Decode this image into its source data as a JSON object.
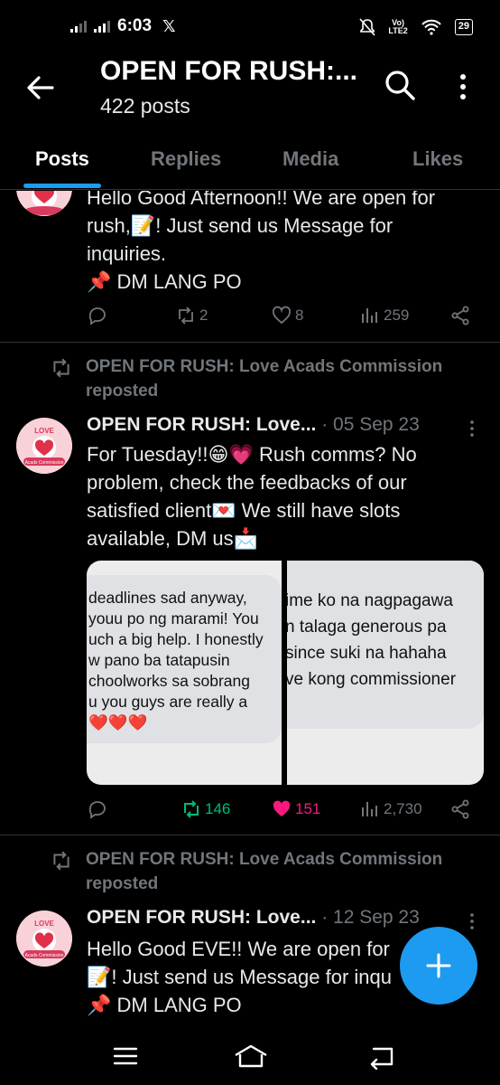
{
  "status_bar": {
    "time": "6:03",
    "x_glyph": "𝕏",
    "lte_label": "LTE2",
    "battery": "29"
  },
  "header": {
    "title": "OPEN FOR RUSH:...",
    "subtitle": "422 posts"
  },
  "tabs": [
    "Posts",
    "Replies",
    "Media",
    "Likes"
  ],
  "active_tab": "Posts",
  "colors": {
    "accent": "#1d9bf0",
    "repost_active": "#00ba7c",
    "like_active": "#f91880",
    "muted": "#71767b"
  },
  "posts": [
    {
      "text_lines": [
        "Hello Good Afternoon!! We are open for",
        "rush,📝! Just send us Message for",
        "inquiries.",
        "📌 DM LANG PO"
      ],
      "replies": "",
      "reposts": "2",
      "likes": "8",
      "views": "259"
    },
    {
      "repost_by": "OPEN FOR RUSH: Love Acads Commission",
      "repost_label": "reposted",
      "author": "OPEN FOR RUSH: Love...",
      "date": "· 05 Sep 23",
      "text_lines": [
        "For Tuesday!!😁💗 Rush comms? No",
        "problem, check the feedbacks of our",
        "satisfied client💌 We still have slots",
        "available, DM us📩"
      ],
      "media": [
        {
          "lines": [
            "deadlines sad anyway,",
            "youu po ng marami! You",
            "uch a big help. I honestly",
            "w pano ba tatapusin",
            "choolworks sa sobrang",
            "u you guys are really a",
            "❤️❤️❤️"
          ]
        },
        {
          "lines": [
            "ime ko na nagpagawa",
            "n talaga generous pa",
            "since suki na hahaha",
            "ve kong commissioner"
          ]
        }
      ],
      "replies": "",
      "reposts": "146",
      "likes": "151",
      "views": "2,730"
    },
    {
      "repost_by": "OPEN FOR RUSH: Love Acads Commission",
      "repost_label": "reposted",
      "author": "OPEN FOR RUSH: Love...",
      "date": "· 12 Sep 23",
      "text_lines": [
        "Hello Good EVE!! We are open for",
        "📝! Just send us Message for inqu",
        "📌 DM LANG PO"
      ]
    }
  ],
  "avatar_text": {
    "top": "LOVE",
    "bottom": "Acads Commission"
  },
  "icons": {
    "back": "arrow-left-icon",
    "search": "search-icon",
    "more": "more-vertical-icon",
    "reply": "reply-icon",
    "repost": "repost-icon",
    "like": "heart-icon",
    "views": "views-icon",
    "share": "share-icon",
    "compose": "plus-icon",
    "nav_menu": "menu-icon",
    "nav_home": "home-icon",
    "nav_back": "back-icon"
  }
}
